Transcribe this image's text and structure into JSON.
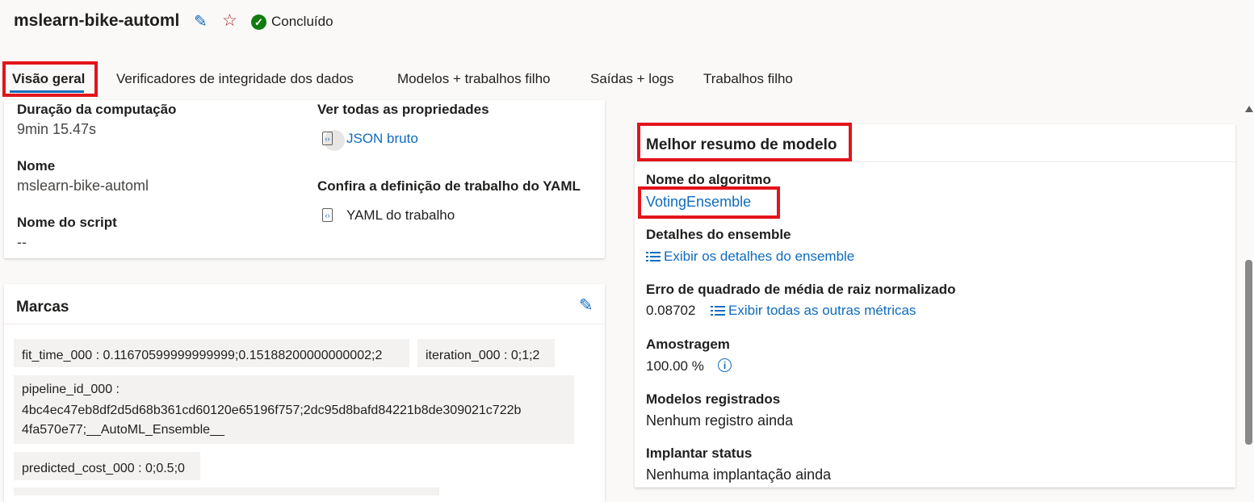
{
  "header": {
    "title": "mslearn-bike-automl",
    "status": "Concluído",
    "edit_icon": "pencil-icon",
    "favorite_icon": "star-icon",
    "status_icon": "check-circle-icon"
  },
  "tabs": [
    {
      "label": "Visão geral"
    },
    {
      "label": "Verificadores de integridade dos dados"
    },
    {
      "label": "Modelos + trabalhos filho"
    },
    {
      "label": "Saídas + logs"
    },
    {
      "label": "Trabalhos filho"
    }
  ],
  "properties": {
    "compute_duration_label": "Duração da computação",
    "compute_duration_value": "9min 15.47s",
    "name_label": "Nome",
    "name_value": "mslearn-bike-automl",
    "script_label": "Nome do script",
    "script_value": "--",
    "all_props_label": "Ver todas as propriedades",
    "raw_json_link": "JSON bruto",
    "yaml_label": "Confira a definição de trabalho do YAML",
    "yaml_link": "YAML do trabalho"
  },
  "tags_card": {
    "title": "Marcas",
    "tags": [
      "fit_time_000 : 0.11670599999999999;0.15188200000000002;2",
      "iteration_000 : 0;1;2",
      "pipeline_id_000 :",
      "4bc4ec47eb8df2d5d68b361cd60120e65196f757;2dc95d8bafd84221b8de309021c722b",
      "4fa570e77;__AutoML_Ensemble__",
      "predicted_cost_000 : 0;0.5;0"
    ]
  },
  "best_model": {
    "title": "Melhor resumo de modelo",
    "algorithm_label": "Nome do algoritmo",
    "algorithm_value": "VotingEnsemble",
    "ensemble_label": "Detalhes do ensemble",
    "ensemble_link": "Exibir os detalhes do ensemble",
    "metric_label": "Erro de quadrado de média de raiz normalizado",
    "metric_value": "0.08702",
    "metrics_link": "Exibir todas as outras métricas",
    "sampling_label": "Amostragem",
    "sampling_value": "100.00 %",
    "registered_label": "Modelos registrados",
    "registered_value": "Nenhum registro ainda",
    "deploy_label": "Implantar status",
    "deploy_value": "Nenhuma implantação ainda"
  },
  "colors": {
    "accent": "#0f6cbd",
    "highlight": "#e3141b",
    "success": "#107c10"
  }
}
